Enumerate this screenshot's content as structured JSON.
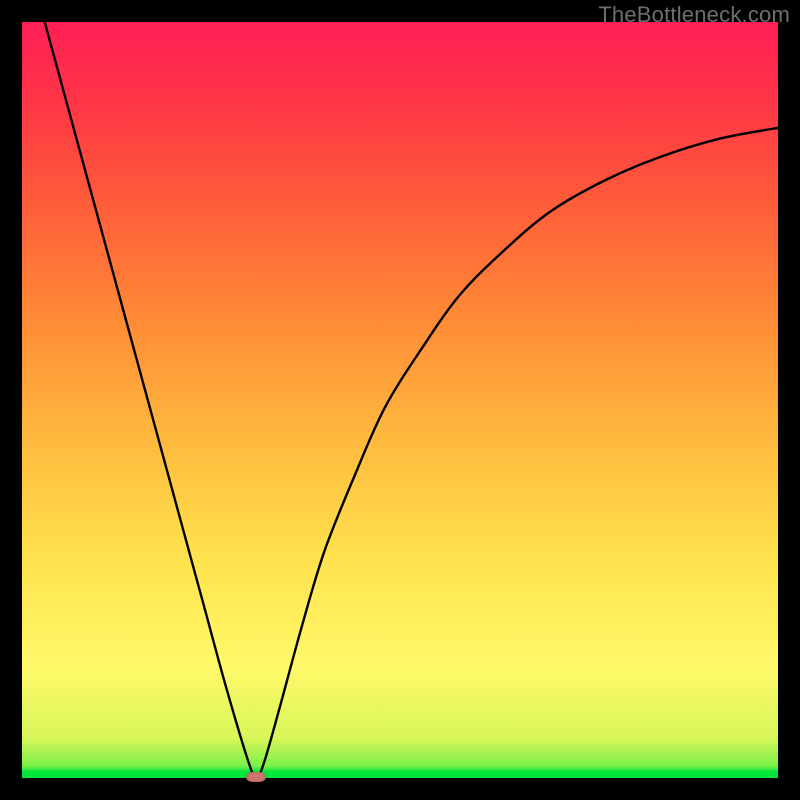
{
  "watermark": "TheBottleneck.com",
  "chart_data": {
    "type": "line",
    "title": "",
    "xlabel": "",
    "ylabel": "",
    "xlim": [
      0,
      100
    ],
    "ylim": [
      0,
      100
    ],
    "grid": false,
    "legend": false,
    "series": [
      {
        "name": "bottleneck-curve",
        "x": [
          3,
          6,
          9,
          12,
          15,
          18,
          21,
          24,
          27,
          30,
          31,
          32,
          34,
          37,
          40,
          44,
          48,
          53,
          58,
          64,
          70,
          77,
          84,
          92,
          100
        ],
        "y": [
          100,
          89,
          78,
          67,
          56,
          45,
          34,
          23,
          12,
          2,
          0,
          2,
          9,
          20,
          30,
          40,
          49,
          57,
          64,
          70,
          75,
          79,
          82,
          84.5,
          86
        ]
      }
    ],
    "marker": {
      "x": 31,
      "y": 0,
      "color": "#c9766d"
    },
    "background_gradient": {
      "bottom": "#00e63a",
      "mid": "#fff96a",
      "top": "#ff1f56"
    }
  }
}
